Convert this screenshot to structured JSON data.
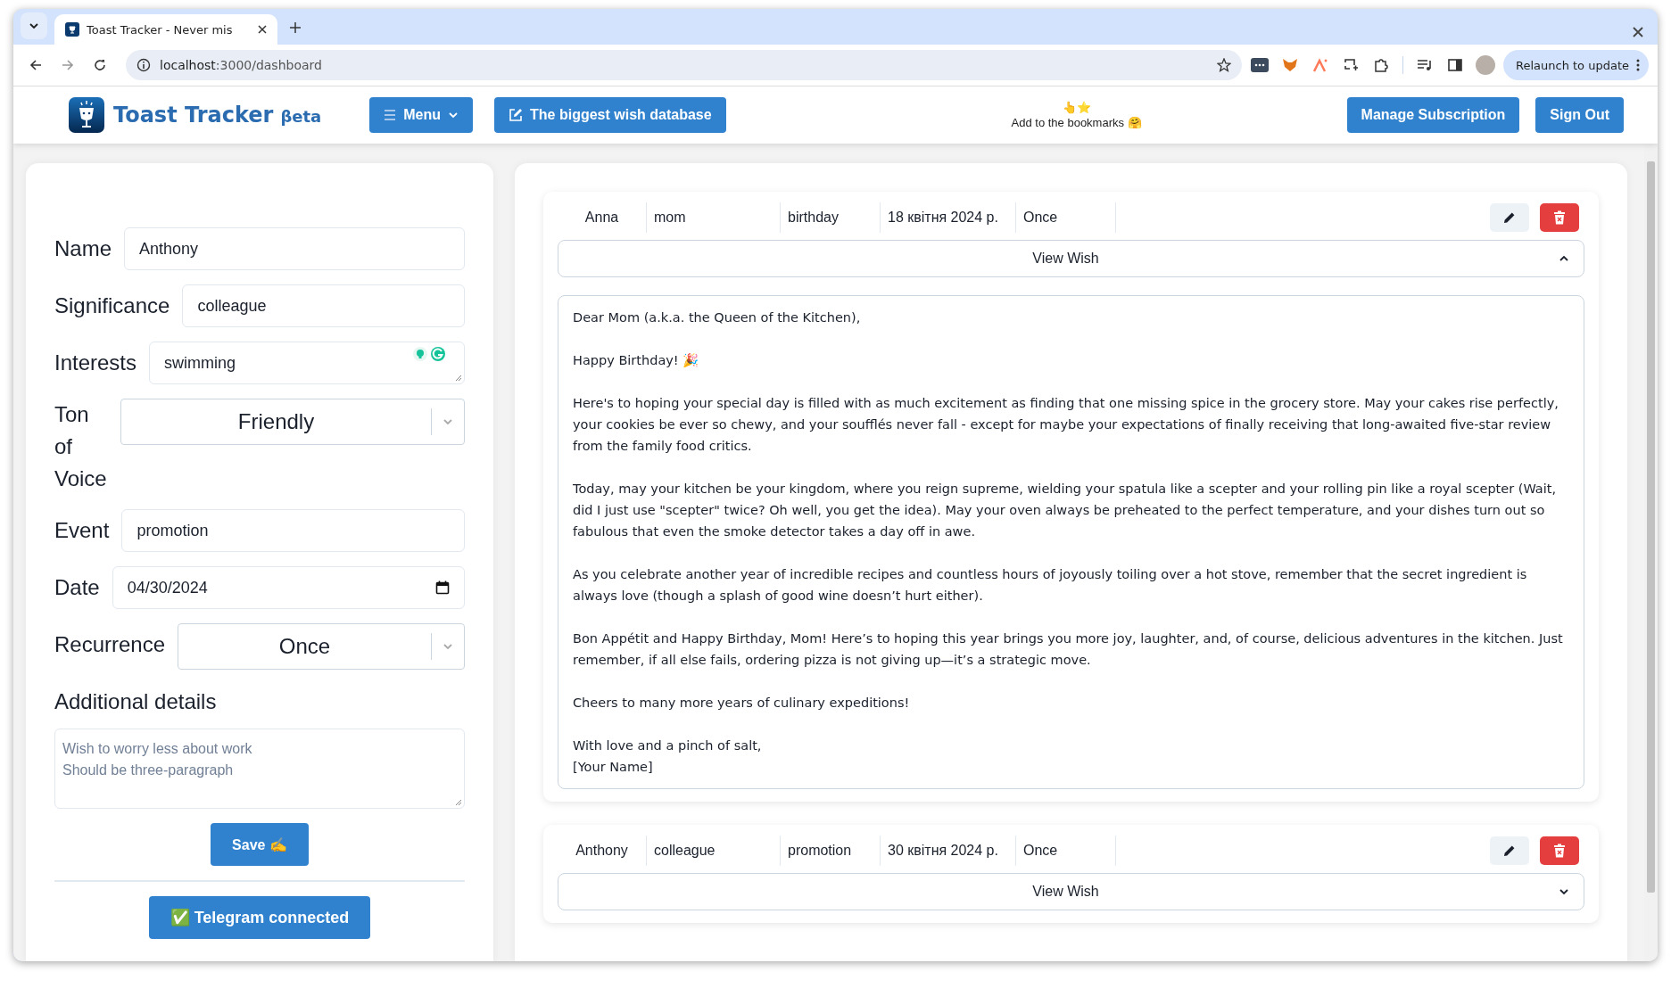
{
  "browser": {
    "tabs": [
      {
        "title": "Toast Tracker - Never mis",
        "selected": true
      }
    ],
    "url_host": "localhost",
    "url_path": ":3000/dashboard",
    "relaunch": "Relaunch to update"
  },
  "header": {
    "brand": "Toast Tracker",
    "beta": "βeta",
    "menu": "Menu",
    "wish_database": "The biggest wish database",
    "bookmark_emoji": "👆⭐",
    "bookmark_text": "Add to the bookmarks 🤗",
    "buttons": [
      "Manage Subscription",
      "Sign Out"
    ]
  },
  "form": {
    "fields": [
      {
        "label": "Name",
        "value": "Anthony",
        "kind": "text"
      },
      {
        "label": "Significance",
        "value": "colleague",
        "kind": "text"
      },
      {
        "label": "Interests",
        "value": "swimming",
        "kind": "textarea"
      },
      {
        "label": "Ton of Voice",
        "value": "Friendly",
        "kind": "select"
      },
      {
        "label": "Event",
        "value": "promotion",
        "kind": "text"
      },
      {
        "label": "Date",
        "value": "04/30/2024",
        "kind": "date"
      },
      {
        "label": "Recurrence",
        "value": "Once",
        "kind": "select"
      }
    ],
    "details_label": "Additional details",
    "details_placeholder": "Wish to worry less about work\nShould be three-paragraph",
    "save": "Save ✍️",
    "telegram": "✅ Telegram connected"
  },
  "wishes": [
    {
      "cells": [
        "Anna",
        "mom",
        "birthday",
        "18 квітня 2024 р.",
        "Once"
      ],
      "toggle": "View Wish",
      "expanded": true,
      "paragraphs": [
        "Dear Mom (a.k.a. the Queen of the Kitchen),",
        "Happy Birthday! 🎉",
        "Here's to hoping your special day is filled with as much excitement as finding that one missing spice in the grocery store. May your cakes rise perfectly, your cookies be ever so chewy, and your soufflés never fall - except for maybe your expectations of finally receiving that long-awaited five-star review from the family food critics.",
        "Today, may your kitchen be your kingdom, where you reign supreme, wielding your spatula like a scepter and your rolling pin like a royal scepter (Wait, did I just use \"scepter\" twice? Oh well, you get the idea). May your oven always be preheated to the perfect temperature, and your dishes turn out so fabulous that even the smoke detector takes a day off in awe.",
        "As you celebrate another year of incredible recipes and countless hours of joyously toiling over a hot stove, remember that the secret ingredient is always love (though a splash of good wine doesn’t hurt either).",
        "Bon Appétit and Happy Birthday, Mom! Here’s to hoping this year brings you more joy, laughter, and, of course, delicious adventures in the kitchen. Just remember, if all else fails, ordering pizza is not giving up—it’s a strategic move.",
        "Cheers to many more years of culinary expeditions!",
        "With love and a pinch of salt,\n[Your Name]"
      ]
    },
    {
      "cells": [
        "Anthony",
        "colleague",
        "promotion",
        "30 квітня 2024 р.",
        "Once"
      ],
      "toggle": "View Wish",
      "expanded": false
    }
  ]
}
